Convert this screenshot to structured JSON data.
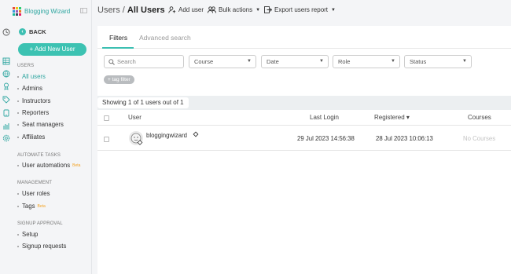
{
  "brand": {
    "name": "Blogging Wizard",
    "logo_colors": [
      "#e74c3c",
      "#f1c40f",
      "#2ecc71",
      "#3498db",
      "#9b59b6",
      "#e67e22",
      "#1abc9c",
      "#34495e",
      "#e91e63"
    ]
  },
  "colors": {
    "accent": "#3cbfb2",
    "beta": "#f3a323"
  },
  "rail_icons": [
    "history-icon",
    "grid-icon",
    "globe-icon",
    "award-icon",
    "tag-icon",
    "tablet-icon",
    "chart-icon",
    "settings-icon"
  ],
  "sidebar": {
    "back_label": "BACK",
    "add_user_label": "+ Add New User",
    "users_section": "USERS",
    "users_items": [
      {
        "label": "All users"
      },
      {
        "label": "Admins"
      },
      {
        "label": "Instructors"
      },
      {
        "label": "Reporters"
      },
      {
        "label": "Seat managers"
      },
      {
        "label": "Affiliates"
      }
    ],
    "automate_section": "AUTOMATE TASKS",
    "automate_items": [
      {
        "label": "User automations",
        "badge": "Beta"
      }
    ],
    "management_section": "MANAGEMENT",
    "management_items": [
      {
        "label": "User roles"
      },
      {
        "label": "Tags",
        "badge": "Beta"
      }
    ],
    "signup_section": "SIGNUP APPROVAL",
    "signup_items": [
      {
        "label": "Setup"
      },
      {
        "label": "Signup requests"
      }
    ]
  },
  "header": {
    "crumb_parent": "Users",
    "crumb_sep": "/",
    "crumb_current": "All Users",
    "add_user": "Add user",
    "bulk_actions": "Bulk actions",
    "export_report": "Export users report"
  },
  "tabs": {
    "filters": "Filters",
    "advanced": "Advanced search"
  },
  "filters": {
    "search_placeholder": "Search",
    "course": "Course",
    "date": "Date",
    "role": "Role",
    "status": "Status",
    "tag_filter": "+ tag filter"
  },
  "summary": "Showing 1 of 1 users out of 1",
  "table": {
    "headers": {
      "user": "User",
      "last_login": "Last Login",
      "registered": "Registered ▾",
      "courses": "Courses"
    },
    "rows": [
      {
        "user": "bloggingwizard",
        "last_login": "29 Jul 2023 14:56:38",
        "registered": "28 Jul 2023 10:06:13",
        "courses": "No Courses"
      }
    ]
  }
}
